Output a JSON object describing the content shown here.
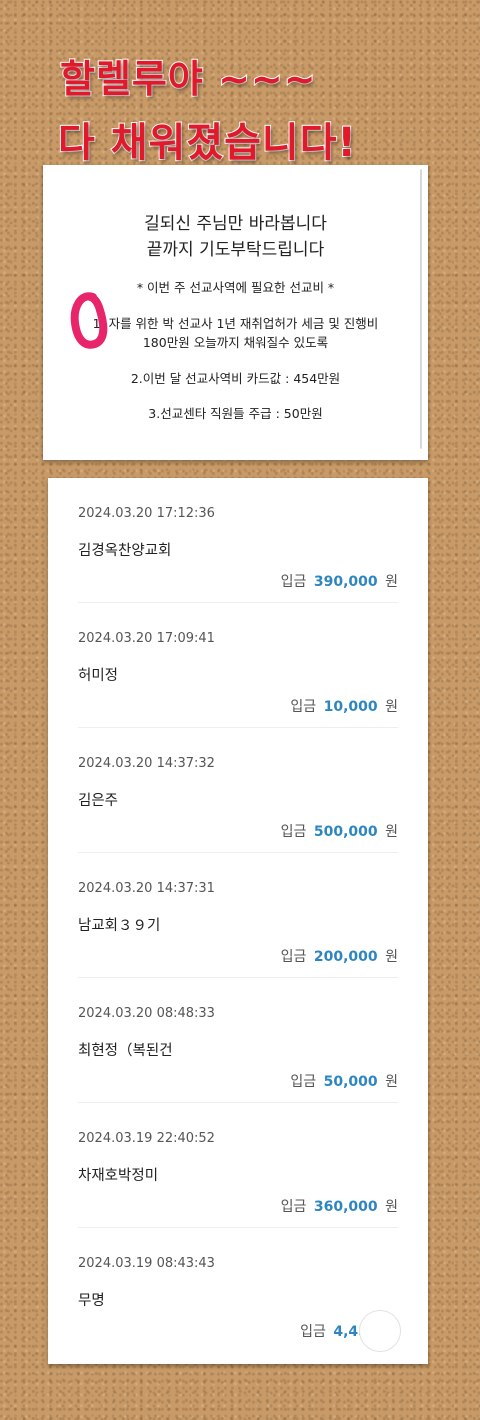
{
  "headline": {
    "line1": "할렐루야 ~~~",
    "line2": "다 채워졌습니다!"
  },
  "prayer": {
    "line1": "길되신 주님만 바라봅니다",
    "line2": "끝까지 기도부탁드립니다",
    "line3": "* 이번 주 선교사역에 필요한 선교비 *",
    "line4": "1. 자를 위한 박 선교사 1년 재취업허가 세금 및 진행비",
    "line5": "180만원 오늘까지 채워질수 있도록",
    "line6": "2.이번 달 선교사역비 카드값 : 454만원",
    "line7": "3.선교센타 직원들 주급 : 50만원"
  },
  "transactions": [
    {
      "datetime": "2024.03.20 17:12:36",
      "name": "김경옥찬양교회",
      "type": "입금",
      "amount": "390,000",
      "unit": "원"
    },
    {
      "datetime": "2024.03.20 17:09:41",
      "name": "허미정",
      "type": "입금",
      "amount": "10,000",
      "unit": "원"
    },
    {
      "datetime": "2024.03.20 14:37:32",
      "name": "김은주",
      "type": "입금",
      "amount": "500,000",
      "unit": "원"
    },
    {
      "datetime": "2024.03.20 14:37:31",
      "name": "남교회３９기",
      "type": "입금",
      "amount": "200,000",
      "unit": "원"
    },
    {
      "datetime": "2024.03.20 08:48:33",
      "name": "최현정（복된건",
      "type": "입금",
      "amount": "50,000",
      "unit": "원"
    },
    {
      "datetime": "2024.03.19 22:40:52",
      "name": "차재호박정미",
      "type": "입금",
      "amount": "360,000",
      "unit": "원"
    },
    {
      "datetime": "2024.03.19 08:43:43",
      "name": "무명",
      "type": "입금",
      "amount": "4,457",
      "unit": "원"
    }
  ],
  "colors": {
    "headline": "#e1192b",
    "amount": "#2e86c1",
    "background": "#c89a67"
  }
}
